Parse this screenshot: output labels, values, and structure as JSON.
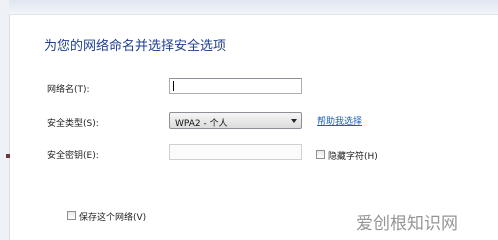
{
  "title": "为您的网络命名并选择安全选项",
  "fields": {
    "network_name_label": "网络名(T):",
    "network_name_value": "",
    "security_type_label": "安全类型(S):",
    "security_type_value": "WPA2 - 个人",
    "security_key_label": "安全密钥(E):",
    "security_key_value": ""
  },
  "help_link": "帮助我选择",
  "hide_chars_label": "隐藏字符(H)",
  "save_network_label": "保存这个网络(V)",
  "watermark": "爱创根知识网"
}
